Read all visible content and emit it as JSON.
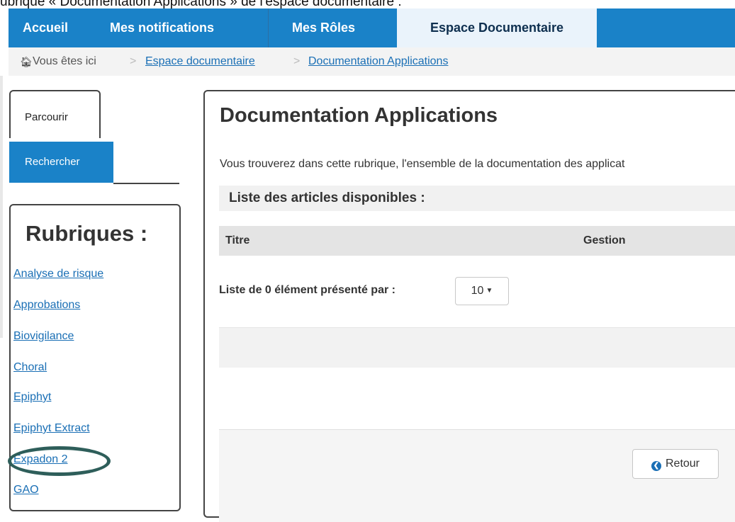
{
  "caption": "ubrique « Documentation Applications » de l'espace documentaire :",
  "nav": {
    "items": [
      {
        "label": "Accueil"
      },
      {
        "label": "Mes notifications"
      },
      {
        "label": "Mes Rôles"
      },
      {
        "label": "Espace Documentaire",
        "active": true
      }
    ]
  },
  "breadcrumb": {
    "home_icon": "home-icon",
    "prefix": "Vous êtes ici",
    "separator": ">",
    "links": [
      "Espace documentaire",
      "Documentation Applications"
    ]
  },
  "tabs": {
    "browse": "Parcourir",
    "search": "Rechercher"
  },
  "rubriques": {
    "title": "Rubriques :",
    "items": [
      "Analyse de risque",
      "Approbations",
      "Biovigilance",
      "Choral",
      "Epiphyt",
      "Epiphyt Extract",
      "Expadon 2",
      "GAO"
    ],
    "highlighted": "Expadon 2"
  },
  "main": {
    "title": "Documentation Applications",
    "description": "Vous trouverez dans cette rubrique, l'ensemble de la documentation des applicat",
    "list_header": "Liste des articles disponibles :",
    "table": {
      "columns": [
        "Titre",
        "Gestion"
      ]
    },
    "pager_label": "Liste de 0 élément présenté par :",
    "page_size": "10",
    "back_button": "Retour"
  },
  "colors": {
    "nav_bg": "#1a82c8",
    "nav_active_bg": "#eaf3fb",
    "link": "#1a6fb5",
    "highlight_oval": "#2e5e5a"
  }
}
